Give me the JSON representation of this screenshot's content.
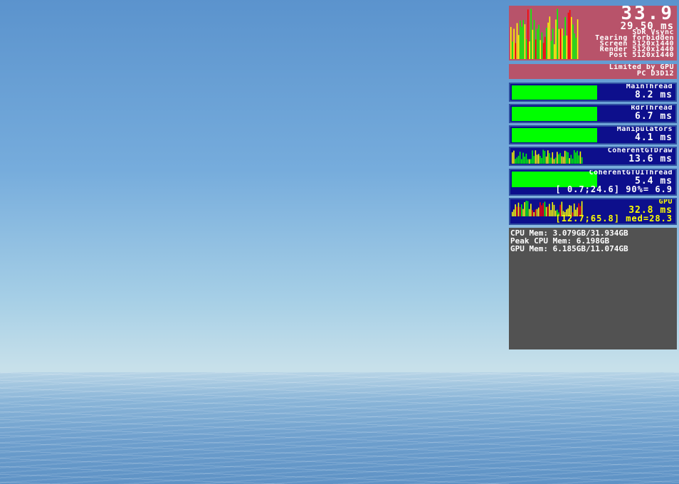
{
  "fps": {
    "value": "33.9",
    "frame_ms": "29.50 ms",
    "sync": "SDR Vsync",
    "tearing": "Tearing forbidden",
    "screen": "Screen 5120x1440",
    "render": "Render 5120x1440",
    "post": "Post 5120x1440"
  },
  "limit": {
    "line1": "Limited by GPU",
    "line2": "PC D3D12"
  },
  "threads": [
    {
      "name": "MainThread",
      "value": "8.2 ms",
      "fill": 0.51
    },
    {
      "name": "RdrThread",
      "value": "6.7 ms",
      "fill": 0.51
    },
    {
      "name": "Manipulators",
      "value": "4.1 ms",
      "fill": 0.51
    },
    {
      "name": "CoherentGTDraw",
      "value": "13.6 ms"
    },
    {
      "name": "CoherentGTUIThread",
      "value": "5.4 ms",
      "stats": "[ 0.7;24.6] 90%= 6.9",
      "fill": 0.51
    }
  ],
  "gpu": {
    "name": "GPU",
    "value": "32.8 ms",
    "stats": "[12.7;65.8] med=28.3"
  },
  "memory": {
    "cpu": "CPU Mem: 3.079GB/31.934GB",
    "peak": "Peak CPU Mem: 6.198GB",
    "gpu": "GPU Mem: 6.185GB/11.074GB"
  },
  "colors": {
    "panel_pink": "#b8536a",
    "panel_blue": "#0d0f8c",
    "bar_green": "#00ff00",
    "bar_yellow": "#ffff00",
    "bar_red": "#ff0000",
    "mem_gray": "#525252"
  }
}
